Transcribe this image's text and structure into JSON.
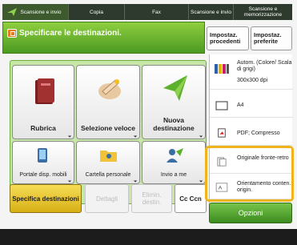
{
  "tabs": [
    {
      "label": "Scansione e invio"
    },
    {
      "label": "Copia"
    },
    {
      "label": "Fax"
    },
    {
      "label": "Scansione e invio"
    },
    {
      "label": "Scansione e memorizzazione"
    }
  ],
  "header": {
    "title": "Specificare le destinazioni."
  },
  "top_buttons": {
    "procedenti": "Impostaz. procedenti",
    "preferite": "Impostaz. preferite"
  },
  "tiles": {
    "rubrica": "Rubrica",
    "selezione": "Selezione veloce",
    "nuova": "Nuova destinazione",
    "portale": "Portale disp. mobili",
    "cartella": "Cartella personale",
    "invio": "Invio a me"
  },
  "actions": {
    "specifica": "Specifica destinazioni",
    "dettagli": "Dettagli",
    "elimina": "Elimin. destin.",
    "cc": "Cc Ccn"
  },
  "settings": {
    "color": "Autom. (Colore/ Scala di grigi)",
    "dpi": "300x300 dpi",
    "size": "A4",
    "format": "PDF; Compresso",
    "originale": "Originale fronte-retro",
    "orientamento": "Orientamento conten. origin."
  },
  "options_button": "Opzioni",
  "colors": {
    "accent_green": "#4c9a22",
    "highlight_yellow": "#f0b41a",
    "dark_bar": "#2d3a2d"
  }
}
